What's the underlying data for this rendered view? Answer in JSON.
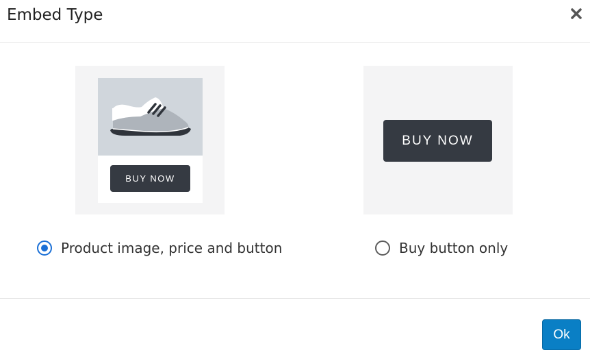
{
  "dialog": {
    "title": "Embed Type",
    "close_icon": "close-icon"
  },
  "options": [
    {
      "label": "Product image, price and button",
      "selected": true,
      "preview_button": "BUY NOW",
      "preview_image_icon": "sneaker-icon"
    },
    {
      "label": "Buy button only",
      "selected": false,
      "preview_button": "BUY NOW"
    }
  ],
  "footer": {
    "ok_label": "Ok"
  },
  "colors": {
    "accent": "#1a6fd6",
    "ok_button": "#0a7fc5",
    "buy_button": "#353a42",
    "panel_bg": "#f4f4f5",
    "image_bg": "#d0d6dc"
  }
}
